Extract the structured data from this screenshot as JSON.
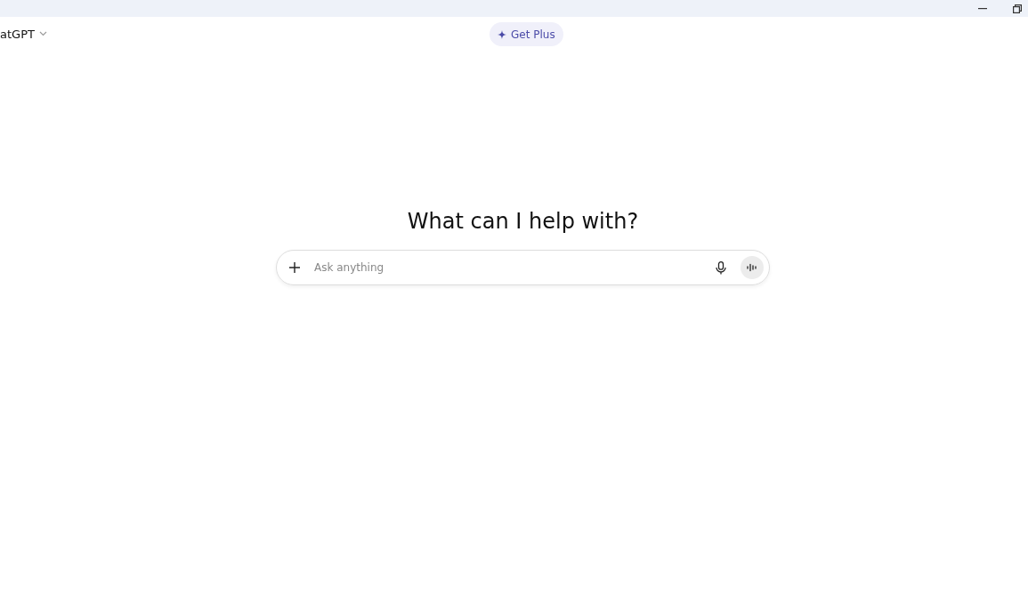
{
  "header": {
    "model_selector": "atGPT",
    "upgrade_button": "Get Plus"
  },
  "main": {
    "heading": "What can I help with?",
    "prompt": {
      "placeholder": "Ask anything"
    }
  }
}
